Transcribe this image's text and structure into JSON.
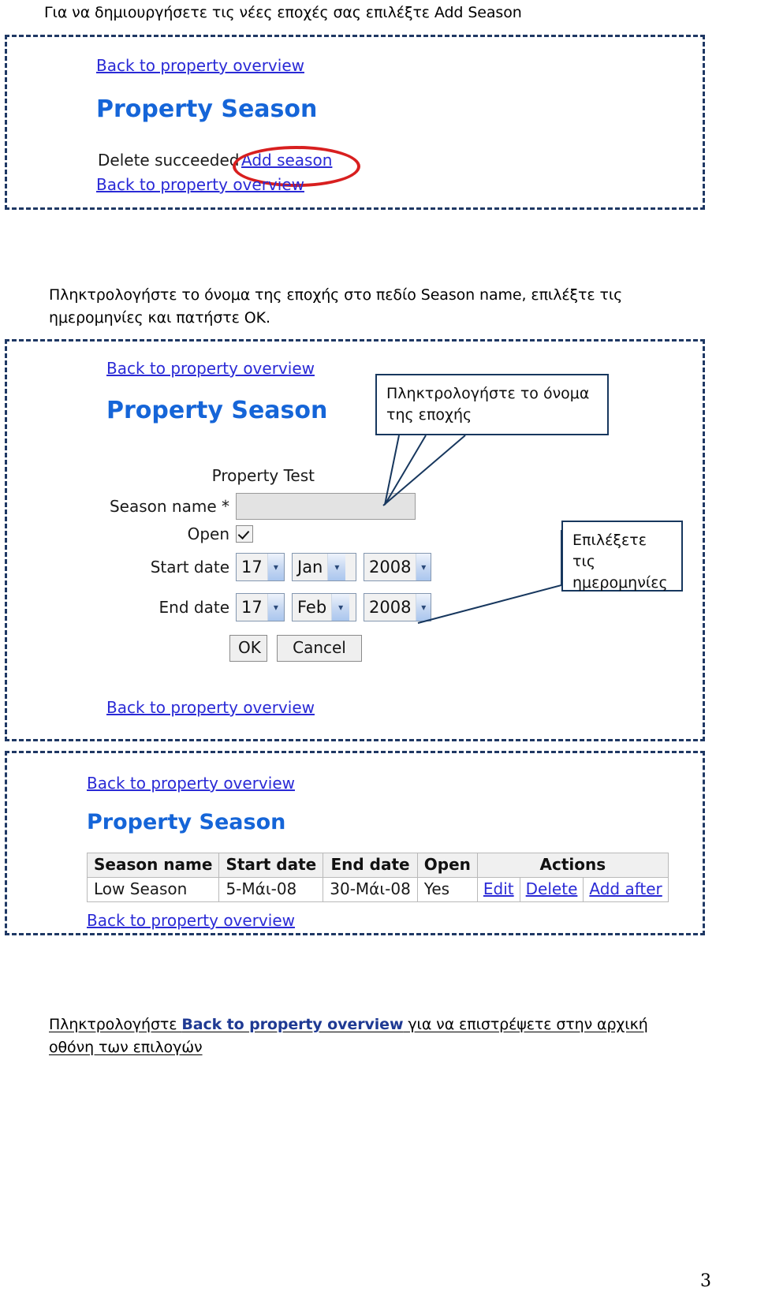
{
  "document": {
    "page_number": "3",
    "instruction_top": "Για να δημιουργήσετε τις νέες εποχές σας επιλέξτε Add Season",
    "instruction_middle": "Πληκτρολογήστε το όνομα της εποχής στο πεδίο Season name, επιλέξτε τις ημερομηνίες και πατήστε ΟΚ.",
    "instruction_bottom_before": "Πληκτρολογήστε ",
    "instruction_bottom_keyword": "Back to property overview",
    "instruction_bottom_after": " για να επιστρέψετε στην αρχική οθόνη των επιλογών"
  },
  "colors": {
    "link": "#2a2ad6",
    "heading": "#1565d8",
    "frame_border": "#1f3864",
    "highlight_ellipse": "#d81f1f",
    "callout_border": "#17375e",
    "keyword": "#1f3a93"
  },
  "screenshot1": {
    "link_top": "Back to property overview",
    "title": "Property Season",
    "message": "Delete succeeded",
    "add_season_link": "Add season",
    "link_bottom": "Back to property overview",
    "highlight": "red-ellipse-around-add-season"
  },
  "screenshot2": {
    "link_top": "Back to property overview",
    "title": "Property Season",
    "property_label": "Property Test",
    "season_name_label": "Season name *",
    "season_name_value": "",
    "open_label": "Open",
    "open_checked": true,
    "start_date_label": "Start date",
    "start_day": "17",
    "start_month": "Jan",
    "start_year": "2008",
    "end_date_label": "End date",
    "end_day": "17",
    "end_month": "Feb",
    "end_year": "2008",
    "ok_button": "OK",
    "cancel_button": "Cancel",
    "link_bottom": "Back to property overview",
    "callout_name": "Πληκτρολογήστε το όνομα της εποχής",
    "callout_dates": "Επιλέξετε τις ημερομηνίες"
  },
  "screenshot3": {
    "link_top": "Back to property overview",
    "title": "Property Season",
    "link_bottom": "Back to property overview",
    "table": {
      "headers": [
        "Season name",
        "Start date",
        "End date",
        "Open",
        "Actions"
      ],
      "rows": [
        {
          "season_name": "Low Season",
          "start_date": "5-Μάι-08",
          "end_date": "30-Μάι-08",
          "open": "Yes",
          "actions": [
            "Edit",
            "Delete",
            "Add after"
          ]
        }
      ]
    }
  }
}
